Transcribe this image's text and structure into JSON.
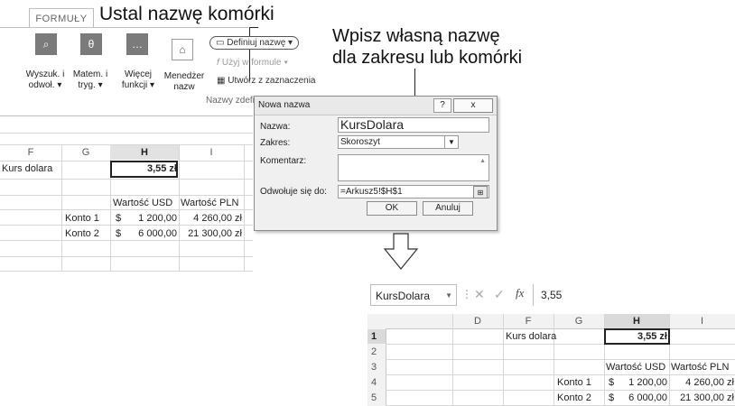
{
  "callouts": {
    "top": "Ustal nazwę komórki",
    "right_line1": "Wpisz własną nazwę",
    "right_line2": "dla zakresu lub komórki"
  },
  "ribbon": {
    "tab": "FORMUŁY",
    "buttons": [
      {
        "line1": "Wyszuk. i",
        "line2": "odwoł. ▾",
        "icon": "search-reference-icon"
      },
      {
        "line1": "Matem. i",
        "line2": "tryg. ▾",
        "icon": "theta-icon"
      },
      {
        "line1": "Więcej",
        "line2": "funkcji ▾",
        "icon": "more-functions-icon"
      },
      {
        "line1": "Menedżer",
        "line2": "nazw",
        "icon": "name-manager-icon"
      }
    ],
    "define_name": "Definiuj nazwę ▾",
    "use_in_formula": "Użyj w formule ▾",
    "create_from_selection": "Utwórz z zaznaczenia",
    "group_label": "Nazwy zdefi"
  },
  "sheet1": {
    "columns": [
      "F",
      "G",
      "H",
      "I"
    ],
    "rows": [
      {
        "F": "Kurs dolara",
        "G": "",
        "H": "3,55 zł",
        "I": ""
      },
      {
        "F": "",
        "G": "",
        "H": "",
        "I": ""
      },
      {
        "F": "",
        "G": "",
        "H": "Wartość USD",
        "I": "Wartość PLN"
      },
      {
        "F": "",
        "G": "Konto 1",
        "H_cur": "$",
        "H": "1 200,00",
        "I": "4 260,00 zł"
      },
      {
        "F": "",
        "G": "Konto 2",
        "H_cur": "$",
        "H": "6 000,00",
        "I": "21 300,00 zł"
      }
    ]
  },
  "dialog": {
    "title": "Nowa nazwa",
    "help": "?",
    "close": "x",
    "name_label": "Nazwa:",
    "name_value": "KursDolara",
    "scope_label": "Zakres:",
    "scope_value": "Skoroszyt",
    "comment_label": "Komentarz:",
    "refers_label": "Odwołuje się do:",
    "refers_value": "=Arkusz5!$H$1",
    "ok": "OK",
    "cancel": "Anuluj"
  },
  "sheet2": {
    "name_box": "KursDolara",
    "fx": "fx",
    "formula_value": "3,55",
    "columns": [
      "D",
      "F",
      "G",
      "H",
      "I"
    ],
    "row_numbers": [
      "1",
      "2",
      "3",
      "4",
      "5"
    ],
    "cells": {
      "r1_F": "Kurs dolara",
      "r1_H": "3,55 zł",
      "r3_H": "Wartość USD",
      "r3_I": "Wartość PLN",
      "r4_G": "Konto 1",
      "r4_Hc": "$",
      "r4_H": "1 200,00",
      "r4_I": "4 260,00 zł",
      "r5_G": "Konto 2",
      "r5_Hc": "$",
      "r5_H": "6 000,00",
      "r5_I": "21 300,00 zł"
    }
  }
}
